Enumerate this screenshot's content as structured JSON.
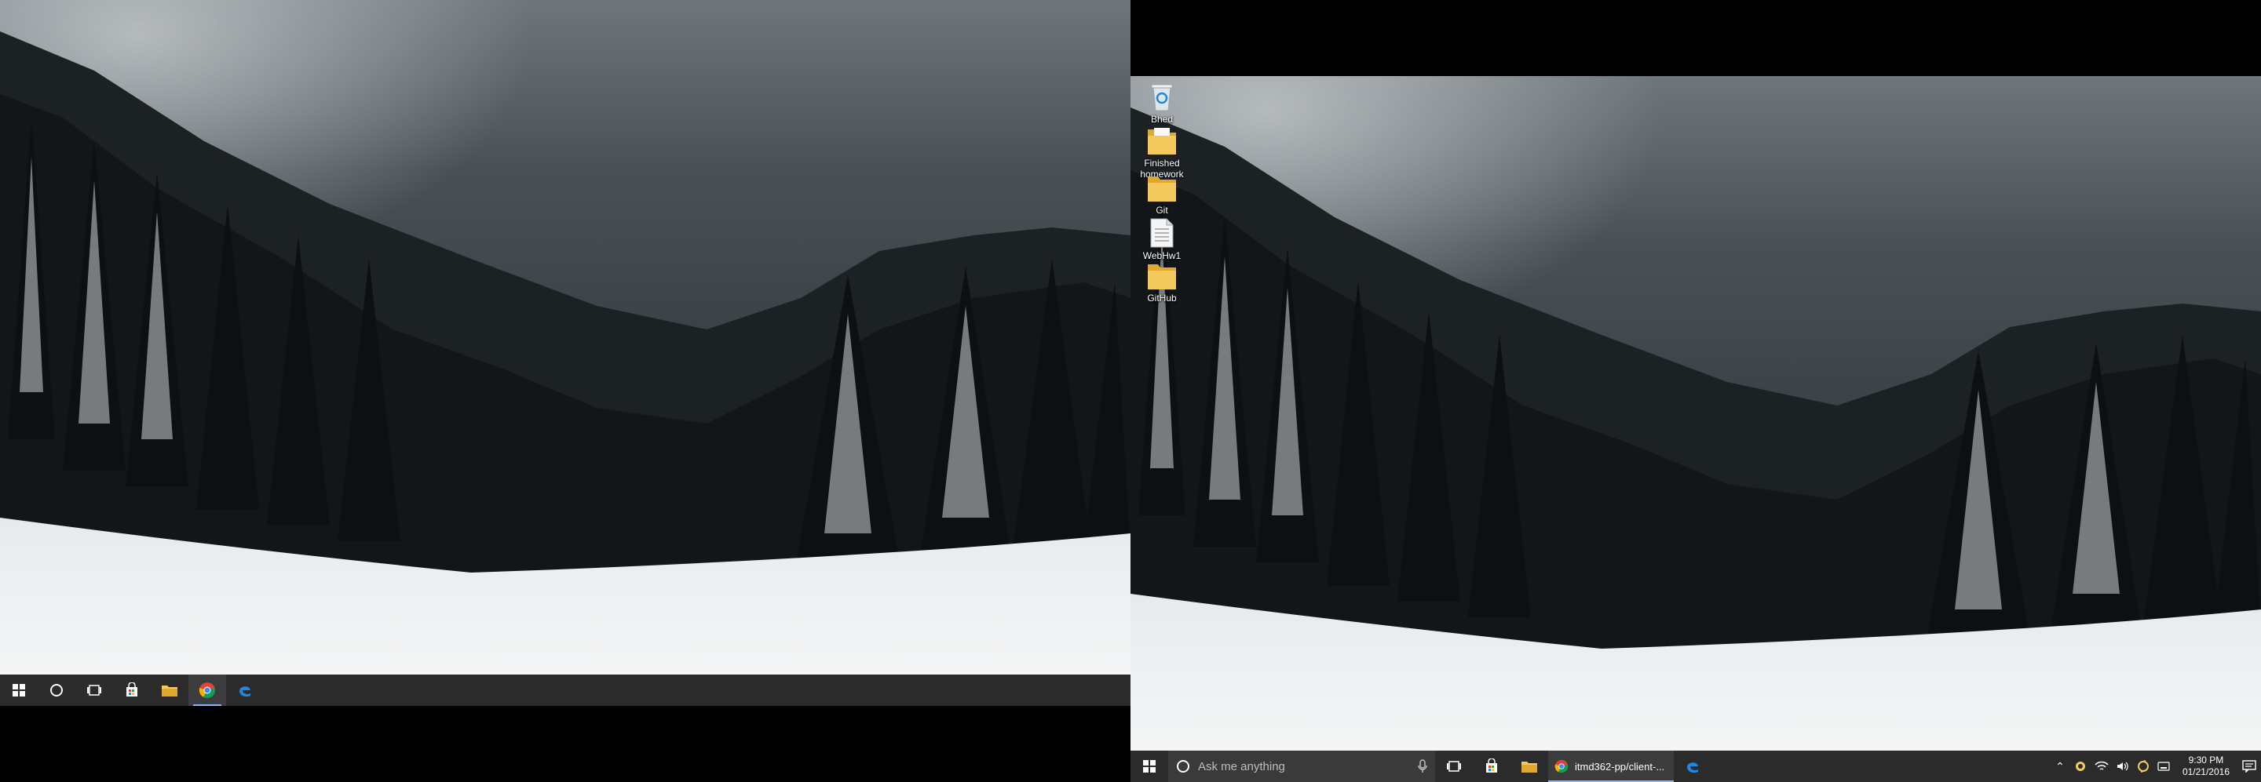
{
  "desktop_icons": [
    {
      "label": "Bhed",
      "icon": "recycle-bin-icon"
    },
    {
      "label": "Finished homework",
      "icon": "folder-icon"
    },
    {
      "label": "Git",
      "icon": "folder-icon"
    },
    {
      "label": "WebHw1",
      "icon": "document-icon"
    },
    {
      "label": "GitHub",
      "icon": "folder-icon"
    }
  ],
  "taskbar": {
    "search_placeholder": "Ask me anything",
    "active_app_label": "itmd362-pp/client-...",
    "clock_time": "9:30 PM",
    "clock_date": "01/21/2016"
  },
  "colors": {
    "taskbar_bg": "#2b2b2b",
    "active_indicator": "#8ab4f8",
    "folder": "#f4c95d",
    "edge_blue": "#1e88e5"
  }
}
